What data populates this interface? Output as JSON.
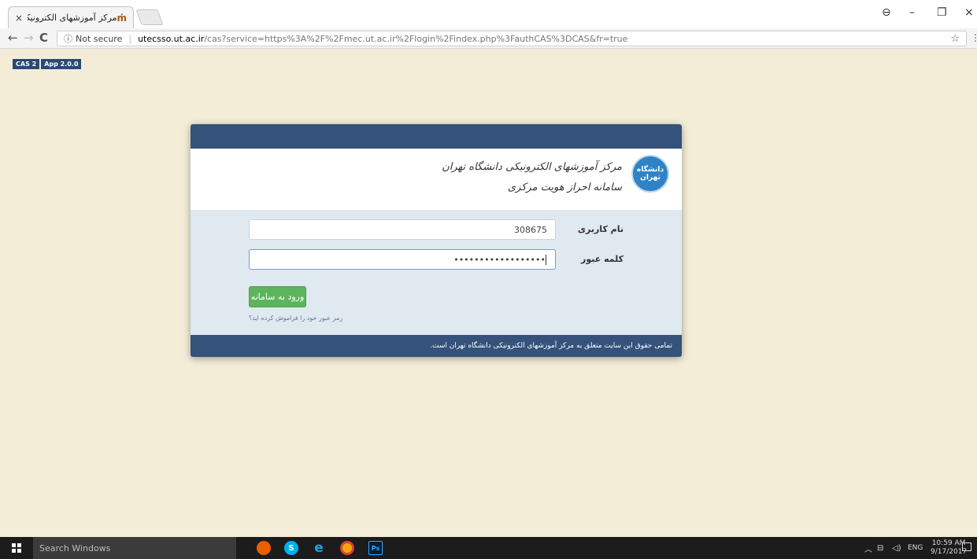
{
  "browser": {
    "tab_title": "مرکز آموزشهای الکترونیک",
    "tab_favicon": "ut-icon",
    "tab_close": "×",
    "window_controls": {
      "account": "account-icon",
      "minimize": "–",
      "restore": "restore-icon",
      "close": "×"
    },
    "nav": {
      "back": "←",
      "forward": "→",
      "reload": "C"
    },
    "url": {
      "security_label": "Not secure",
      "host": "utecsso.ut.ac.ir",
      "path": "/cas?service=https%3A%2F%2Fmec.ut.ac.ir%2Flogin%2Findex.php%3FauthCAS%3DCAS&fr=true"
    }
  },
  "badges": [
    "CAS 2",
    "App 2.0.0"
  ],
  "login": {
    "header_line1": "مرکز آموزشهای الکترونیکی دانشگاه تهران",
    "header_line2": "سامانه احراز هویت مرکزی",
    "seal_text": "دانشگاه تهران",
    "username_label": "نام کاربری",
    "username_value": "308675",
    "password_label": "کلمه عبور",
    "password_value": "••••••••••••••••••",
    "submit_label": "ورود به سامانه",
    "forgot_link": "رمز عبور خود را فراموش کرده اید؟",
    "footer_text": "تمامی حقوق این سایت متعلق به مرکز آموزشهای الکترونیکی دانشگاه تهران است."
  },
  "taskbar": {
    "search_placeholder": "Search Windows",
    "apps": [
      "firefox-icon",
      "skype-icon",
      "internet-explorer-icon",
      "chrome-icon",
      "photoshop-icon"
    ],
    "photoshop_label": "Ps",
    "language": "ENG",
    "time": "10:59 AM",
    "date": "9/17/2017"
  },
  "colors": {
    "page_bg": "#f3edd8",
    "card_bar": "#34527a",
    "button_green": "#5cb55c"
  }
}
